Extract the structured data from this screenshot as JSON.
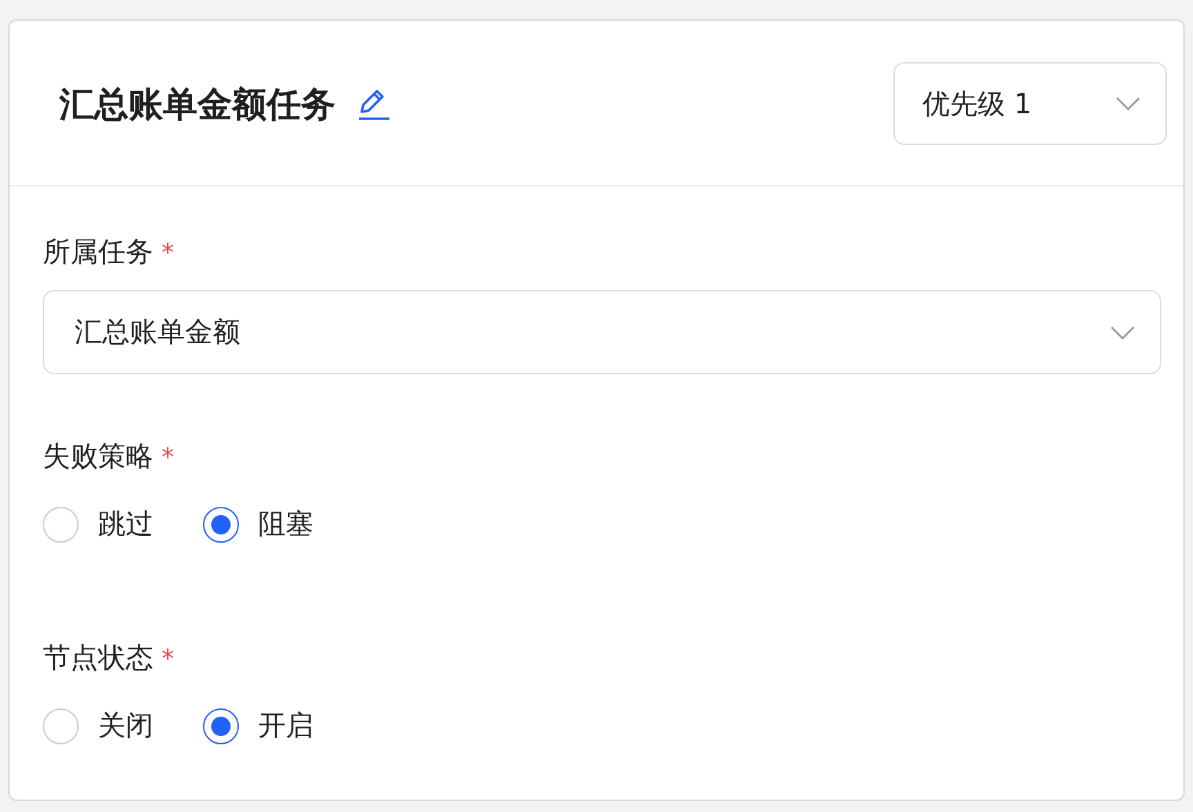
{
  "header": {
    "title": "汇总账单金额任务",
    "priority": {
      "value": "优先级 1"
    }
  },
  "fields": [
    {
      "kind": "select",
      "label": "所属任务",
      "required_mark": "*",
      "value": "汇总账单金额"
    },
    {
      "kind": "radio",
      "label": "失败策略",
      "required_mark": "*",
      "options": [
        {
          "label": "跳过",
          "selected": false
        },
        {
          "label": "阻塞",
          "selected": true
        }
      ]
    },
    {
      "kind": "radio",
      "label": "节点状态",
      "required_mark": "*",
      "options": [
        {
          "label": "关闭",
          "selected": false
        },
        {
          "label": "开启",
          "selected": true
        }
      ]
    }
  ]
}
